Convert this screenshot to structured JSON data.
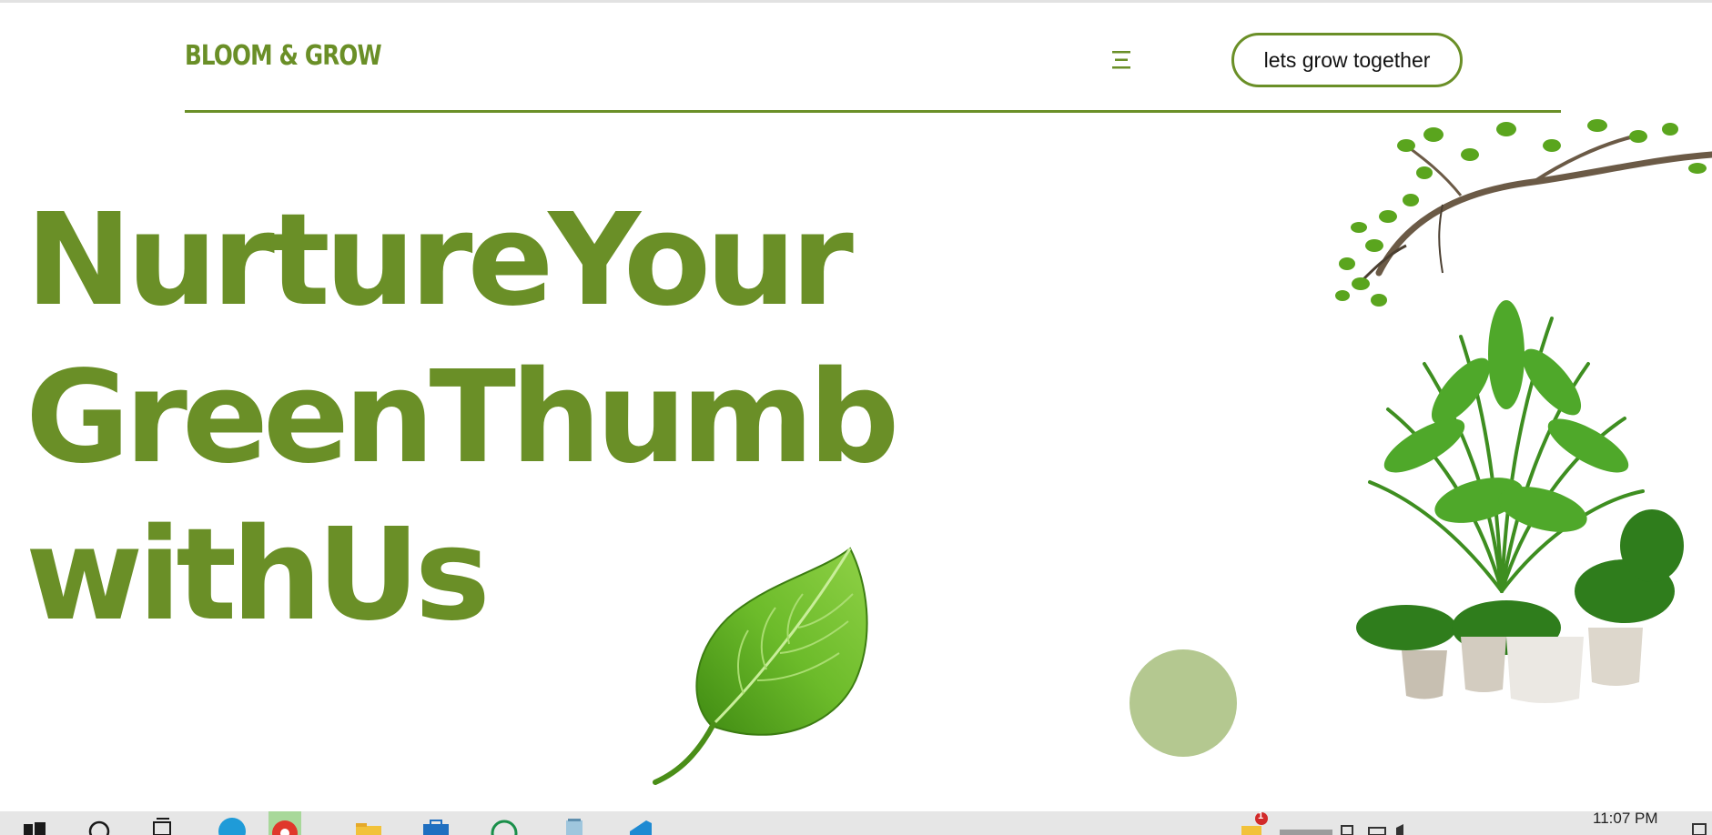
{
  "header": {
    "logo": "BLOOM & GROW",
    "cta_label": "lets grow together",
    "menu_icon": "hamburger-menu-icon"
  },
  "hero": {
    "headline_lines": [
      "NurtureYour",
      "GreenThumb",
      "withUs"
    ]
  },
  "colors": {
    "brand_green": "#6a8f27",
    "soft_green_circle": "#b4c890",
    "background": "#ffffff"
  },
  "taskbar": {
    "icons": [
      "windows-start-icon",
      "search-icon",
      "task-view-icon",
      "edge-browser-icon",
      "chrome-browser-icon",
      "file-explorer-icon",
      "store-icon",
      "whatsapp-icon",
      "notepad-icon",
      "vscode-icon"
    ],
    "notification_badge": "1",
    "clock": "11:07 PM"
  }
}
